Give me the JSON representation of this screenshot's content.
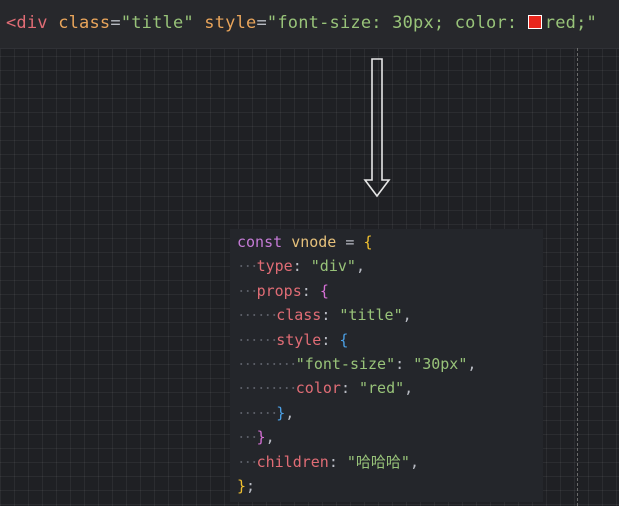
{
  "top_line": {
    "open": "<div ",
    "class_attr": "class",
    "eq1": "=",
    "class_val": "\"title\"",
    "space": " ",
    "style_attr": "style",
    "eq2": "=",
    "style_val_a": "\"font-size: 30px; color: ",
    "swatch_color": "#e8261c",
    "style_val_b": "red;\""
  },
  "code": {
    "const_kw": "const",
    "var_name": "vnode",
    "assign": "=",
    "open_brace": "{",
    "type_key": "type",
    "type_val": "\"div\"",
    "props_key": "props",
    "class_key": "class",
    "class_val": "\"title\"",
    "style_key": "style",
    "font_size_key": "\"font-size\"",
    "font_size_val": "\"30px\"",
    "color_key": "color",
    "color_val": "\"red\"",
    "children_key": "children",
    "children_val": "\"哈哈哈\"",
    "colon": ":",
    "comma": ",",
    "close_brace": "}",
    "semicolon": ";"
  },
  "colors": {
    "background": "#1f2024",
    "code_panel": "#24262b",
    "keyword": "#c57bd6",
    "string": "#98c379",
    "property": "#e06c75"
  }
}
